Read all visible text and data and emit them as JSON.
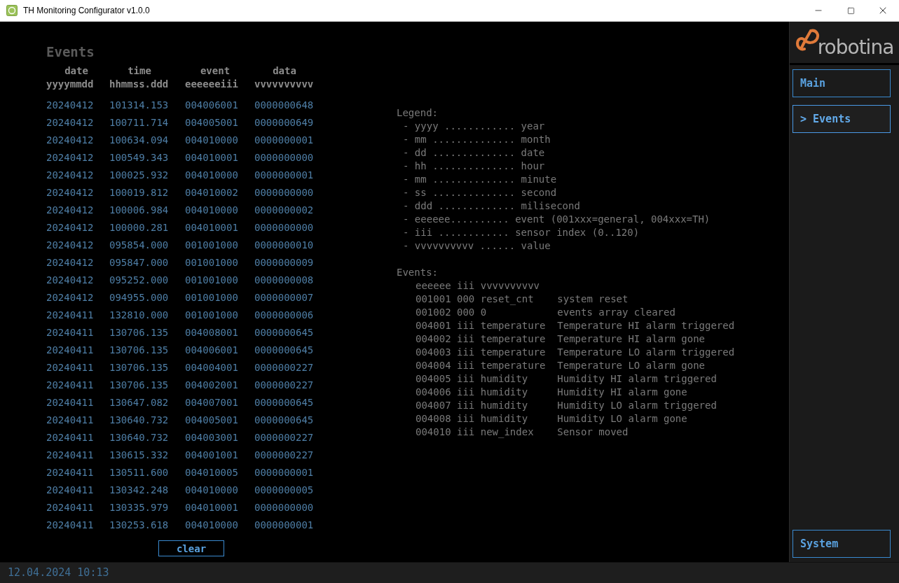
{
  "window": {
    "title": "TH Monitoring Configurator v1.0.0"
  },
  "events": {
    "title": "Events",
    "columns": [
      {
        "name": "date",
        "format": "yyyymmdd"
      },
      {
        "name": "time",
        "format": "hhmmss.ddd"
      },
      {
        "name": "event",
        "format": "eeeeeeiii"
      },
      {
        "name": "data",
        "format": "vvvvvvvvvv"
      }
    ],
    "rows": [
      [
        "20240412",
        "101314.153",
        "004006001",
        "0000000648"
      ],
      [
        "20240412",
        "100711.714",
        "004005001",
        "0000000649"
      ],
      [
        "20240412",
        "100634.094",
        "004010000",
        "0000000001"
      ],
      [
        "20240412",
        "100549.343",
        "004010001",
        "0000000000"
      ],
      [
        "20240412",
        "100025.932",
        "004010000",
        "0000000001"
      ],
      [
        "20240412",
        "100019.812",
        "004010002",
        "0000000000"
      ],
      [
        "20240412",
        "100006.984",
        "004010000",
        "0000000002"
      ],
      [
        "20240412",
        "100000.281",
        "004010001",
        "0000000000"
      ],
      [
        "20240412",
        "095854.000",
        "001001000",
        "0000000010"
      ],
      [
        "20240412",
        "095847.000",
        "001001000",
        "0000000009"
      ],
      [
        "20240412",
        "095252.000",
        "001001000",
        "0000000008"
      ],
      [
        "20240412",
        "094955.000",
        "001001000",
        "0000000007"
      ],
      [
        "20240411",
        "132810.000",
        "001001000",
        "0000000006"
      ],
      [
        "20240411",
        "130706.135",
        "004008001",
        "0000000645"
      ],
      [
        "20240411",
        "130706.135",
        "004006001",
        "0000000645"
      ],
      [
        "20240411",
        "130706.135",
        "004004001",
        "0000000227"
      ],
      [
        "20240411",
        "130706.135",
        "004002001",
        "0000000227"
      ],
      [
        "20240411",
        "130647.082",
        "004007001",
        "0000000645"
      ],
      [
        "20240411",
        "130640.732",
        "004005001",
        "0000000645"
      ],
      [
        "20240411",
        "130640.732",
        "004003001",
        "0000000227"
      ],
      [
        "20240411",
        "130615.332",
        "004001001",
        "0000000227"
      ],
      [
        "20240411",
        "130511.600",
        "004010005",
        "0000000001"
      ],
      [
        "20240411",
        "130342.248",
        "004010000",
        "0000000005"
      ],
      [
        "20240411",
        "130335.979",
        "004010001",
        "0000000000"
      ],
      [
        "20240411",
        "130253.618",
        "004010000",
        "0000000001"
      ]
    ],
    "clear_button": "clear"
  },
  "legend": {
    "title": "Legend:",
    "lines": [
      "- yyyy ............ year",
      "- mm .............. month",
      "- dd .............. date",
      "- hh .............. hour",
      "- mm .............. minute",
      "- ss .............. second",
      "- ddd ............. milisecond",
      "- eeeeee.......... event (001xxx=general, 004xxx=TH)",
      "- iii ............ sensor index (0..120)",
      "- vvvvvvvvvv ...... value"
    ]
  },
  "event_codes": {
    "title": "Events:",
    "lines": [
      "eeeeee iii vvvvvvvvvv",
      "001001 000 reset_cnt    system reset",
      "001002 000 0            events array cleared",
      "004001 iii temperature  Temperature HI alarm triggered",
      "004002 iii temperature  Temperature HI alarm gone",
      "004003 iii temperature  Temperature LO alarm triggered",
      "004004 iii temperature  Temperature LO alarm gone",
      "004005 iii humidity     Humidity HI alarm triggered",
      "004006 iii humidity     Humidity HI alarm gone",
      "004007 iii humidity     Humidity LO alarm triggered",
      "004008 iii humidity     Humidity LO alarm gone",
      "004010 iii new_index    Sensor moved"
    ]
  },
  "sidebar": {
    "logo_text": "robotina",
    "selected_marker": ">",
    "items": [
      {
        "label": "Main",
        "selected": false
      },
      {
        "label": "Events",
        "selected": true
      }
    ],
    "bottom_item": {
      "label": "System",
      "selected": false
    }
  },
  "status_bar": {
    "datetime": "12.04.2024 10:13"
  }
}
